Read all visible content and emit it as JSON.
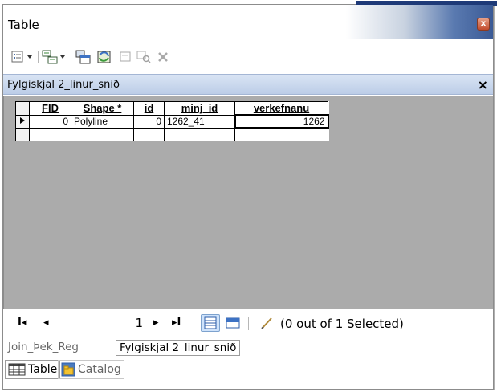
{
  "window": {
    "title": "Table",
    "close_glyph": "x"
  },
  "toolbar": {
    "icons": [
      "table-options-icon",
      "related-tables-icon",
      "select-by-attributes-icon",
      "switch-selection-icon",
      "clear-selection-icon",
      "zoom-to-selected-icon",
      "delete-selected-icon"
    ]
  },
  "table": {
    "name": "Fylgiskjal 2_linur_snið",
    "close_glyph": "×",
    "columns": [
      "FID",
      "Shape *",
      "id",
      "minj_id",
      "verkefnanu"
    ],
    "rows": [
      {
        "FID": "0",
        "Shape": "Polyline",
        "id": "0",
        "minj_id": "1262_41",
        "verkefnanu": "1262"
      }
    ]
  },
  "nav": {
    "first": "I◂",
    "prev": "◂",
    "record": "1",
    "next": "▸",
    "last": "▸I",
    "selection_status": "(0 out of 1 Selected)"
  },
  "table_tabs": [
    "Join_Þek_Reg",
    "Fylgiskjal 2_linur_snið"
  ],
  "bottom_tabs": [
    "Table",
    "Catalog"
  ],
  "colors": {
    "title_bar_accent": "#3a5a96",
    "table_header_bg": "#c9d8ee",
    "grid_bg": "#ababab"
  }
}
